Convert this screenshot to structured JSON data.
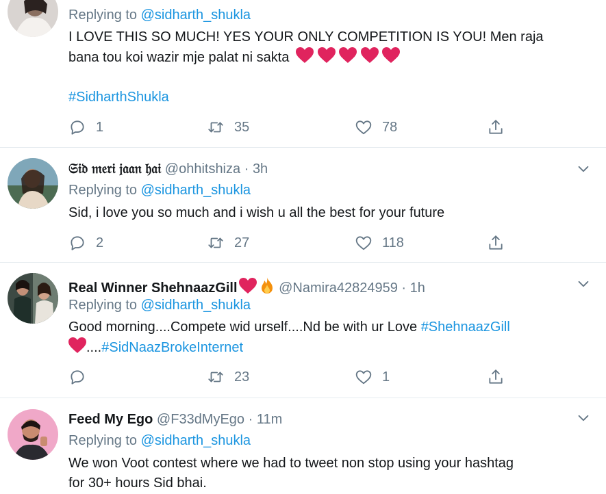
{
  "tweets": [
    {
      "replying_prefix": "Replying to ",
      "replying_to": "@sidharth_shukla",
      "text_line1": "I LOVE THIS SO MUCH! YES YOUR ONLY COMPETITION IS YOU! Men raja",
      "text_line2": "bana tou koi wazir mje palat ni sakta",
      "hashtag": "#SidharthShukla",
      "replies": "1",
      "retweets": "35",
      "likes": "78"
    },
    {
      "name": "𝔖𝔦𝔡 𝔪𝔢𝔯𝔦 𝔧𝔞𝔞𝔫 𝔥𝔞𝔦",
      "handle": "@ohhitshiza",
      "dot": "·",
      "time": "3h",
      "replying_prefix": "Replying to ",
      "replying_to": "@sidharth_shukla",
      "text": "Sid, i love you so much and i wish u all the best for your future",
      "replies": "2",
      "retweets": "27",
      "likes": "118"
    },
    {
      "name": "Real Winner ShehnaazGill",
      "handle": "@Namira42824959",
      "dot": "·",
      "time": "1h",
      "replying_prefix": "Replying to ",
      "replying_to": "@sidharth_shukla",
      "text_a": "Good morning....Compete wid urself....Nd be with ur Love ",
      "hashtag_a": "#ShehnaazGill",
      "text_b": "....",
      "hashtag_b": "#SidNaazBrokeInternet",
      "replies": "",
      "retweets": "23",
      "likes": "1"
    },
    {
      "name": "Feed My Ego",
      "handle": "@F33dMyEgo",
      "dot": "·",
      "time": "11m",
      "replying_prefix": "Replying to ",
      "replying_to": "@sidharth_shukla",
      "text_line1": "We won Voot contest where we had to tweet non stop using your hashtag",
      "text_line2": "for 30+ hours Sid bhai."
    }
  ],
  "icons": {
    "reply": "reply-icon",
    "retweet": "retweet-icon",
    "like": "like-icon",
    "share": "share-icon",
    "more": "chevron-down-icon",
    "heart": "red-heart-emoji",
    "fire": "fire-emoji"
  },
  "colors": {
    "link": "#1b95e0",
    "secondary_text": "#657786",
    "divider": "#e6ecf0",
    "heart": "#e0245e"
  }
}
